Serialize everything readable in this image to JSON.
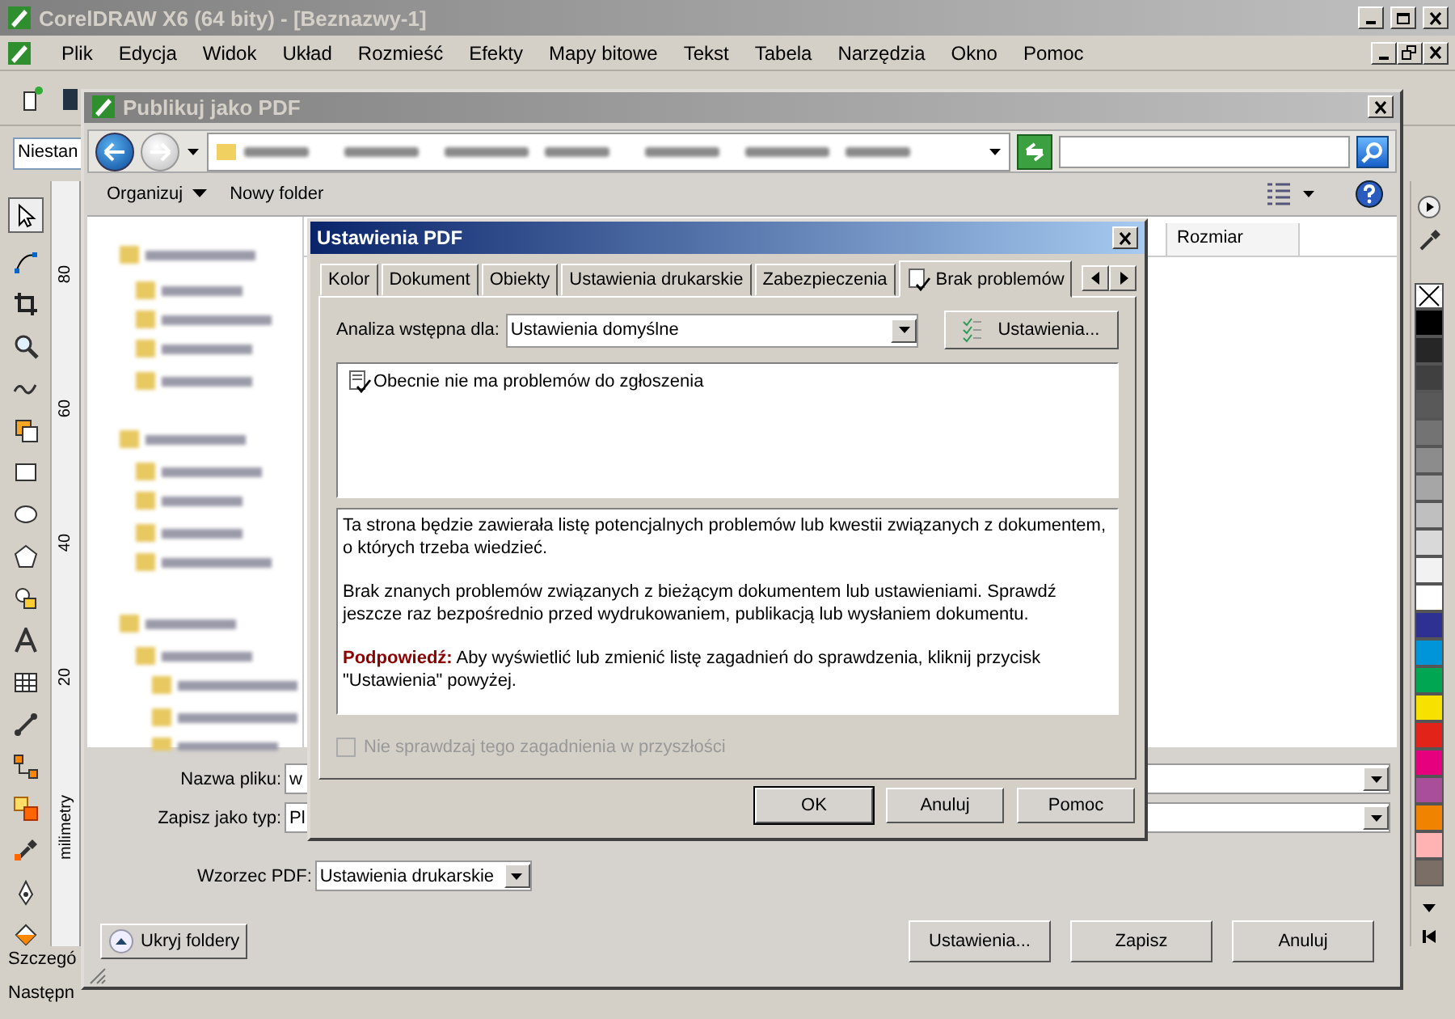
{
  "app": {
    "title": "CorelDRAW X6 (64 bity) - [Beznazwy-1]",
    "menu": [
      "Plik",
      "Edycja",
      "Widok",
      "Układ",
      "Rozmieść",
      "Efekty",
      "Mapy bitowe",
      "Tekst",
      "Tabela",
      "Narzędzia",
      "Okno",
      "Pomoc"
    ],
    "property_field": "Niestan",
    "ruler": {
      "labels": [
        "80",
        "60",
        "40",
        "20"
      ],
      "unit": "milimetry"
    },
    "status": [
      "Szczegó",
      "Następn"
    ],
    "palette": [
      {
        "color": "#000000"
      },
      {
        "color": "#262626"
      },
      {
        "color": "#404040"
      },
      {
        "color": "#595959"
      },
      {
        "color": "#737373"
      },
      {
        "color": "#8c8c8c"
      },
      {
        "color": "#a6a6a6"
      },
      {
        "color": "#bfbfbf"
      },
      {
        "color": "#d9d9d9"
      },
      {
        "color": "#f2f2f2"
      },
      {
        "color": "#ffffff"
      },
      {
        "color": "#2e3192"
      },
      {
        "color": "#0095d9"
      },
      {
        "color": "#00a651"
      },
      {
        "color": "#f7e100"
      },
      {
        "color": "#e2231a"
      },
      {
        "color": "#e6007e"
      },
      {
        "color": "#a94f9a"
      },
      {
        "color": "#f08300"
      },
      {
        "color": "#ffb3b3"
      },
      {
        "color": "#7b6e66"
      }
    ]
  },
  "save_dialog": {
    "title": "Publikuj jako PDF",
    "toolbar": [
      "Organizuj",
      "Nowy folder"
    ],
    "column": "Rozmiar",
    "fields": [
      {
        "label": "Nazwa pliku:",
        "value": "w"
      },
      {
        "label": "Zapisz jako typ:",
        "value": "Pl"
      }
    ],
    "preset": {
      "label": "Wzorzec PDF:",
      "value": "Ustawienia drukarskie"
    },
    "hide_folders": "Ukryj foldery",
    "buttons": [
      "Ustawienia...",
      "Zapisz",
      "Anuluj"
    ]
  },
  "pdf_dialog": {
    "title": "Ustawienia PDF",
    "tabs": [
      {
        "label": "Kolor",
        "selected": false
      },
      {
        "label": "Dokument",
        "selected": false
      },
      {
        "label": "Obiekty",
        "selected": false
      },
      {
        "label": "Ustawienia drukarskie",
        "selected": false
      },
      {
        "label": "Zabezpieczenia",
        "selected": false
      },
      {
        "label": "Brak problemów",
        "selected": true
      }
    ],
    "preflight_label": "Analiza wstępna dla:",
    "preflight_value": "Ustawienia domyślne",
    "settings_button": "Ustawienia...",
    "issues": [
      "Obecnie nie ma problemów do zgłoszenia"
    ],
    "description": [
      "Ta strona będzie zawierała listę potencjalnych problemów lub kwestii związanych z dokumentem, o których trzeba wiedzieć.",
      "Brak znanych problemów związanych z bieżącym dokumentem lub ustawieniami. Sprawdź jeszcze raz bezpośrednio przed wydrukowaniem, publikacją lub wysłaniem dokumentu.",
      "**Podpowiedź:** Aby wyświetlić lub zmienić listę zagadnień do sprawdzenia, kliknij przycisk \"Ustawienia\" powyżej."
    ],
    "dont_check": {
      "label": "Nie sprawdzaj tego zagadnienia w przyszłości",
      "checked": false,
      "disabled": true
    },
    "buttons": [
      {
        "label": "OK",
        "default": true
      },
      {
        "label": "Anuluj",
        "default": false
      },
      {
        "label": "Pomoc",
        "default": false
      }
    ]
  }
}
